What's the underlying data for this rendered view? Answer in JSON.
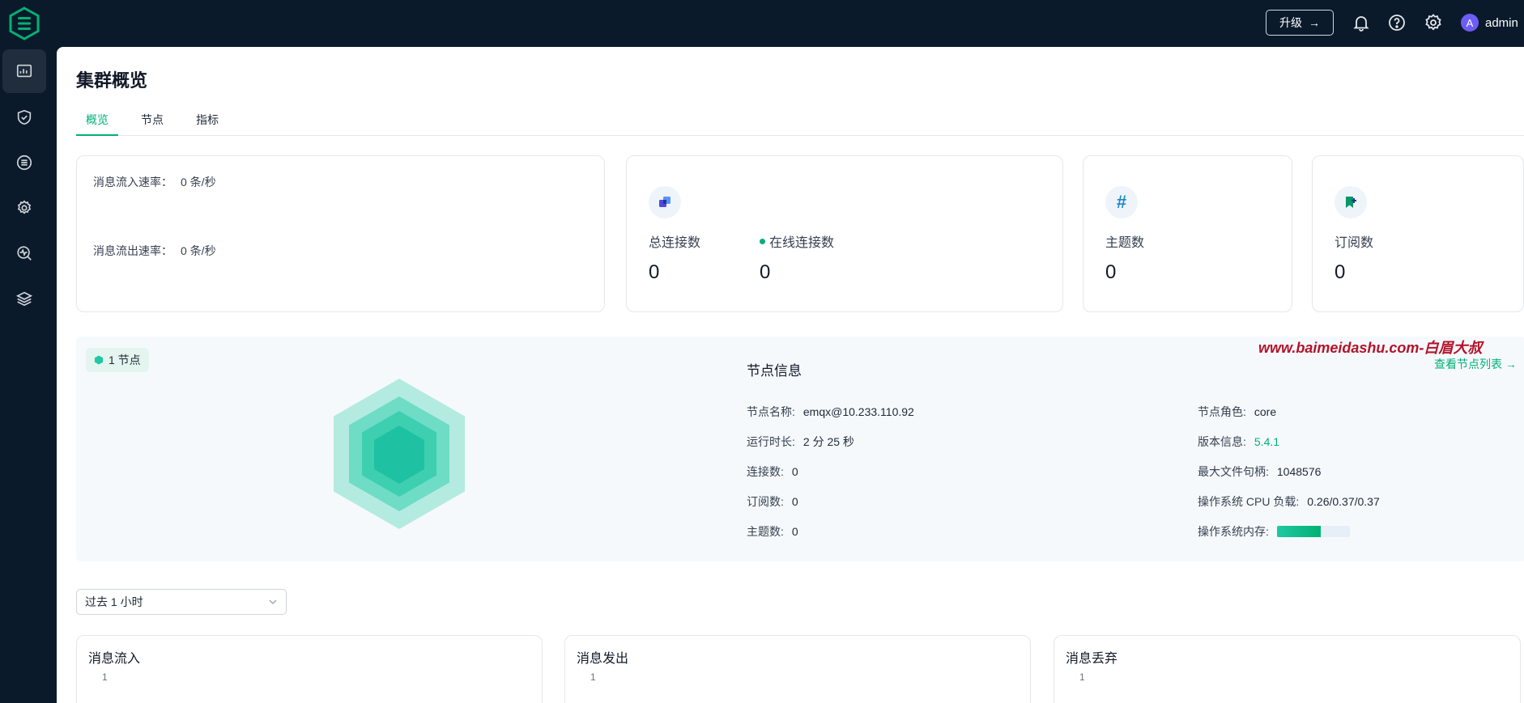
{
  "header": {
    "upgrade_label": "升级",
    "user_initial": "A",
    "user_name": "admin"
  },
  "page": {
    "title": "集群概览",
    "tabs": [
      "概览",
      "节点",
      "指标"
    ]
  },
  "rates": {
    "in_label": "消息流入速率：",
    "in_value": "0 条/秒",
    "out_label": "消息流出速率：",
    "out_value": "0 条/秒"
  },
  "stats": {
    "total_conn_label": "总连接数",
    "total_conn_value": "0",
    "online_conn_label": "在线连接数",
    "online_conn_value": "0",
    "topics_label": "主题数",
    "topics_value": "0",
    "subs_label": "订阅数",
    "subs_value": "0"
  },
  "node": {
    "badge": "1 节点",
    "title": "节点信息",
    "list_link": "查看节点列表 →",
    "watermark": "www.baimeidashu.com-白眉大叔",
    "left": [
      {
        "label": "节点名称:",
        "value": "emqx@10.233.110.92"
      },
      {
        "label": "运行时长:",
        "value": "2 分 25 秒"
      },
      {
        "label": "连接数:",
        "value": "0"
      },
      {
        "label": "订阅数:",
        "value": "0"
      },
      {
        "label": "主题数:",
        "value": "0"
      }
    ],
    "right": [
      {
        "label": "节点角色:",
        "value": "core"
      },
      {
        "label": "版本信息:",
        "value": "5.4.1"
      },
      {
        "label": "最大文件句柄:",
        "value": "1048576"
      },
      {
        "label": "操作系统 CPU 负载:",
        "value": "0.26/0.37/0.37"
      },
      {
        "label": "操作系统内存:",
        "value": ""
      }
    ],
    "memory_fraction": 0.6
  },
  "time_range": {
    "selected": "过去 1 小时"
  },
  "charts": [
    {
      "title": "消息流入",
      "tick": "1"
    },
    {
      "title": "消息发出",
      "tick": "1"
    },
    {
      "title": "消息丢弃",
      "tick": "1"
    }
  ],
  "colors": {
    "brand": "#00b173",
    "nav_bg": "#0b1a2b",
    "avatar": "#6e5cf6"
  },
  "icons": {
    "nav": [
      "dashboard-icon",
      "shield-icon",
      "integration-icon",
      "settings-gear-icon",
      "diagnose-icon",
      "extensions-icon"
    ],
    "top": [
      "bell-icon",
      "help-icon",
      "gear-icon"
    ]
  }
}
